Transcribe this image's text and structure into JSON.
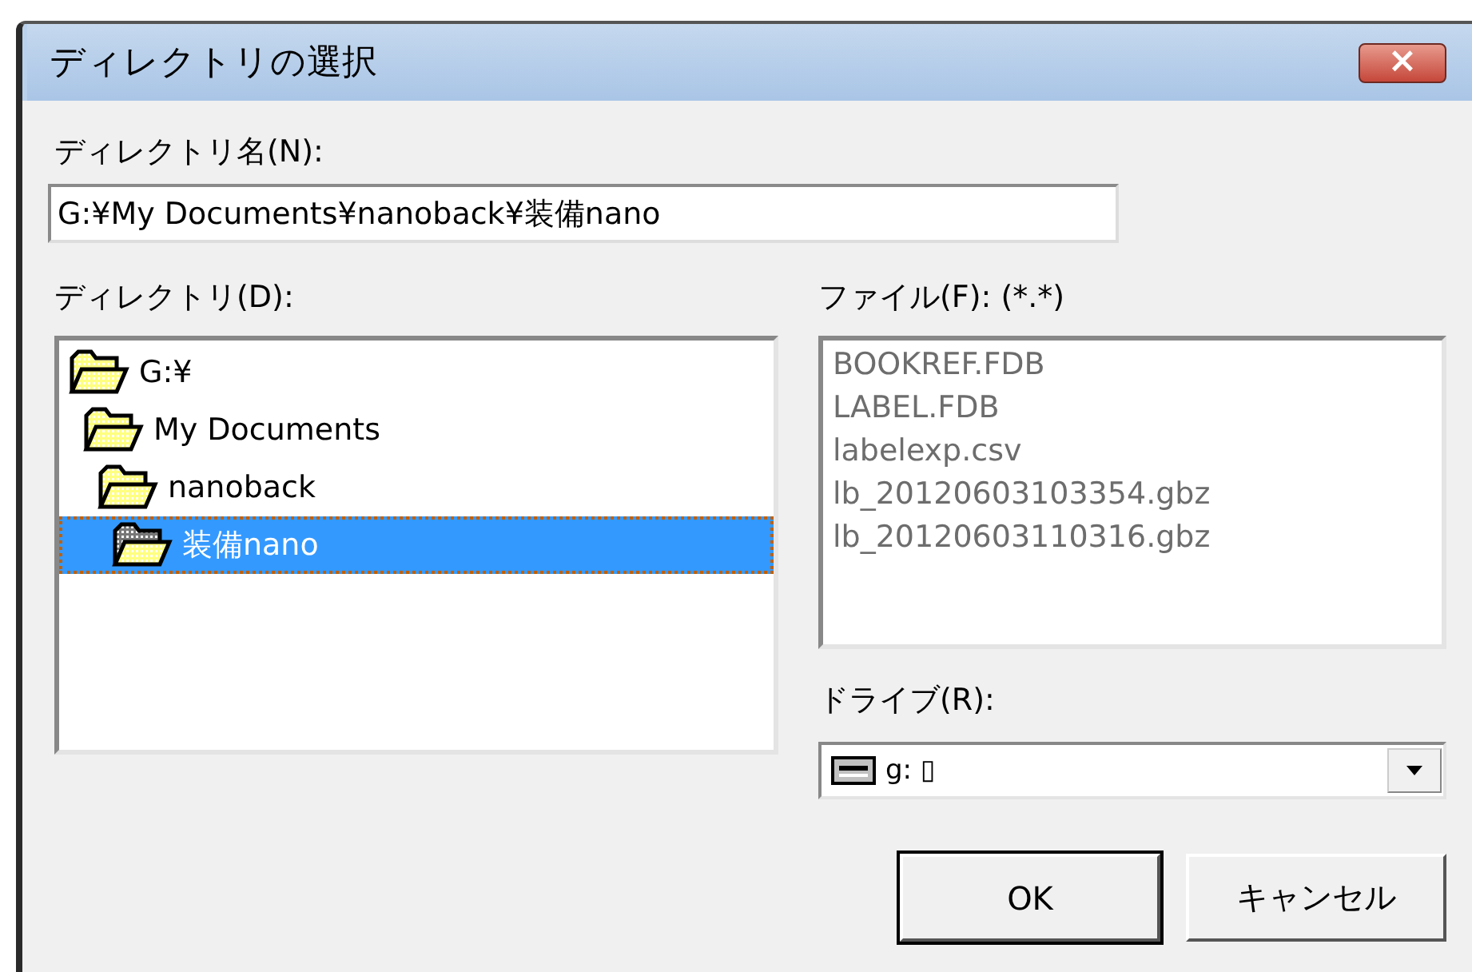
{
  "window": {
    "title": "ディレクトリの選択",
    "close": "×"
  },
  "directory_name": {
    "label": "ディレクトリ名(N):",
    "value": "G:¥My Documents¥nanoback¥装備nano"
  },
  "directories": {
    "label": "ディレクトリ(D):",
    "items": [
      {
        "label": "G:¥",
        "selected": false,
        "children": [
          {
            "label": "My Documents",
            "selected": false,
            "children": [
              {
                "label": "nanoback",
                "selected": false,
                "children": [
                  {
                    "label": "装備nano",
                    "selected": true
                  }
                ]
              }
            ]
          }
        ]
      }
    ]
  },
  "files": {
    "label": "ファイル(F): (*.*)",
    "items": [
      "BOOKREF.FDB",
      "LABEL.FDB",
      "labelexp.csv",
      "lb_20120603103354.gbz",
      "lb_20120603110316.gbz"
    ]
  },
  "drive": {
    "label": "ドライブ(R):",
    "value": "g: ▯"
  },
  "buttons": [
    {
      "label": "OK",
      "default": true
    },
    {
      "label": "キャンセル",
      "default": false
    }
  ]
}
